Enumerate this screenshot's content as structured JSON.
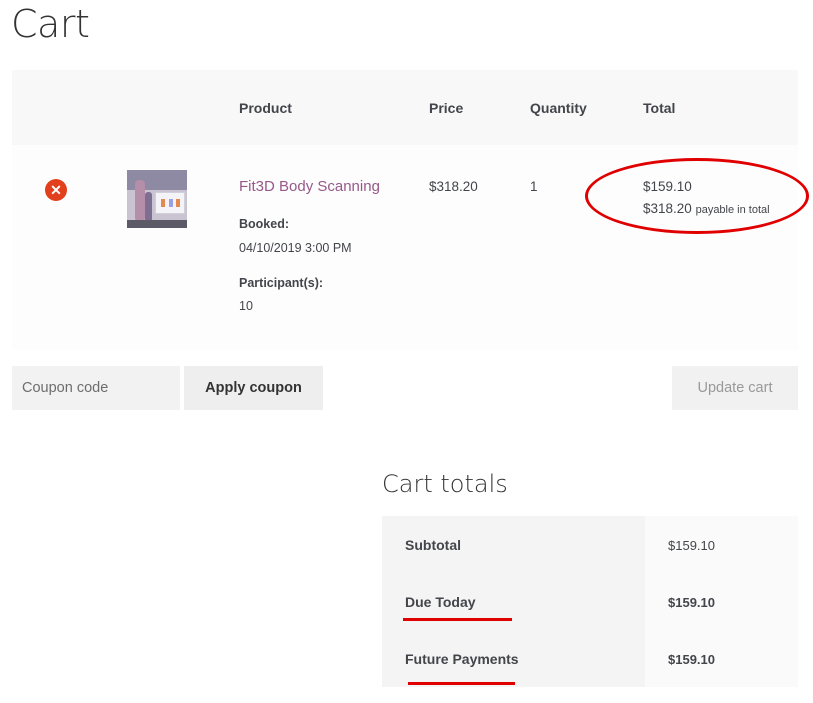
{
  "page_title": "Cart",
  "cart": {
    "headers": {
      "product": "Product",
      "price": "Price",
      "quantity": "Quantity",
      "total": "Total"
    },
    "items": [
      {
        "name": "Fit3D Body Scanning",
        "booked_label": "Booked:",
        "booked_value": "04/10/2019 3:00 PM",
        "participants_label": "Participant(s):",
        "participants_value": "10",
        "price": "$318.20",
        "quantity": "1",
        "total": "$159.10",
        "total_payable": "$318.20",
        "total_payable_note": "payable in total"
      }
    ]
  },
  "coupon": {
    "placeholder": "Coupon code",
    "apply_label": "Apply coupon"
  },
  "update_label": "Update cart",
  "totals": {
    "title": "Cart totals",
    "rows": [
      {
        "label": "Subtotal",
        "value": "$159.10"
      },
      {
        "label": "Due Today",
        "value": "$159.10"
      },
      {
        "label": "Future Payments",
        "value": "$159.10"
      }
    ]
  },
  "colors": {
    "accent": "#96588a",
    "remove": "#e2401c",
    "annotation": "#e00000"
  },
  "icons": {
    "remove": "close-circle-icon"
  }
}
